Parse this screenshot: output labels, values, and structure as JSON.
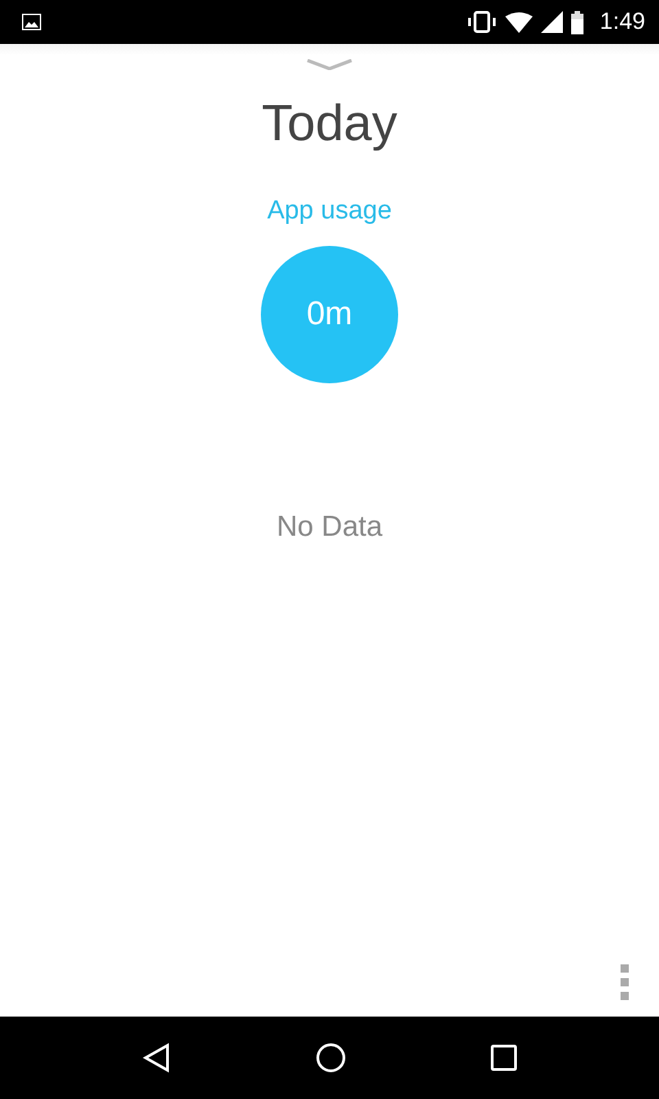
{
  "status_bar": {
    "time": "1:49"
  },
  "title": "Today",
  "usage": {
    "label": "App usage",
    "total": "0m"
  },
  "empty_message": "No Data"
}
